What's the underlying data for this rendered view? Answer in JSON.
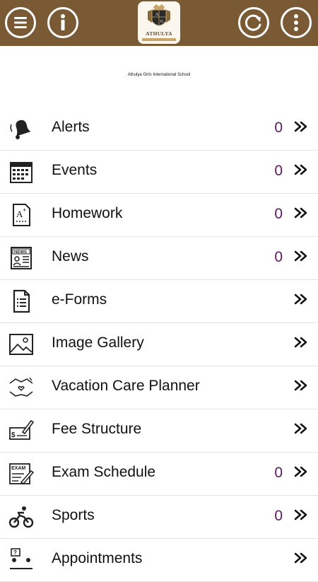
{
  "header": {
    "logo_text": "ATHULYA",
    "logo_initials": "A G",
    "school_name": "Athulya Girls International School"
  },
  "menu": [
    {
      "label": "Alerts",
      "count": "0"
    },
    {
      "label": "Events",
      "count": "0"
    },
    {
      "label": "Homework",
      "count": "0"
    },
    {
      "label": "News",
      "count": "0"
    },
    {
      "label": "e-Forms",
      "count": ""
    },
    {
      "label": "Image Gallery",
      "count": ""
    },
    {
      "label": "Vacation Care Planner",
      "count": ""
    },
    {
      "label": "Fee Structure",
      "count": ""
    },
    {
      "label": "Exam Schedule",
      "count": "0"
    },
    {
      "label": "Sports",
      "count": "0"
    },
    {
      "label": "Appointments",
      "count": ""
    }
  ],
  "colors": {
    "header_bg": "#7a5a34",
    "count": "#5c1a5c"
  }
}
